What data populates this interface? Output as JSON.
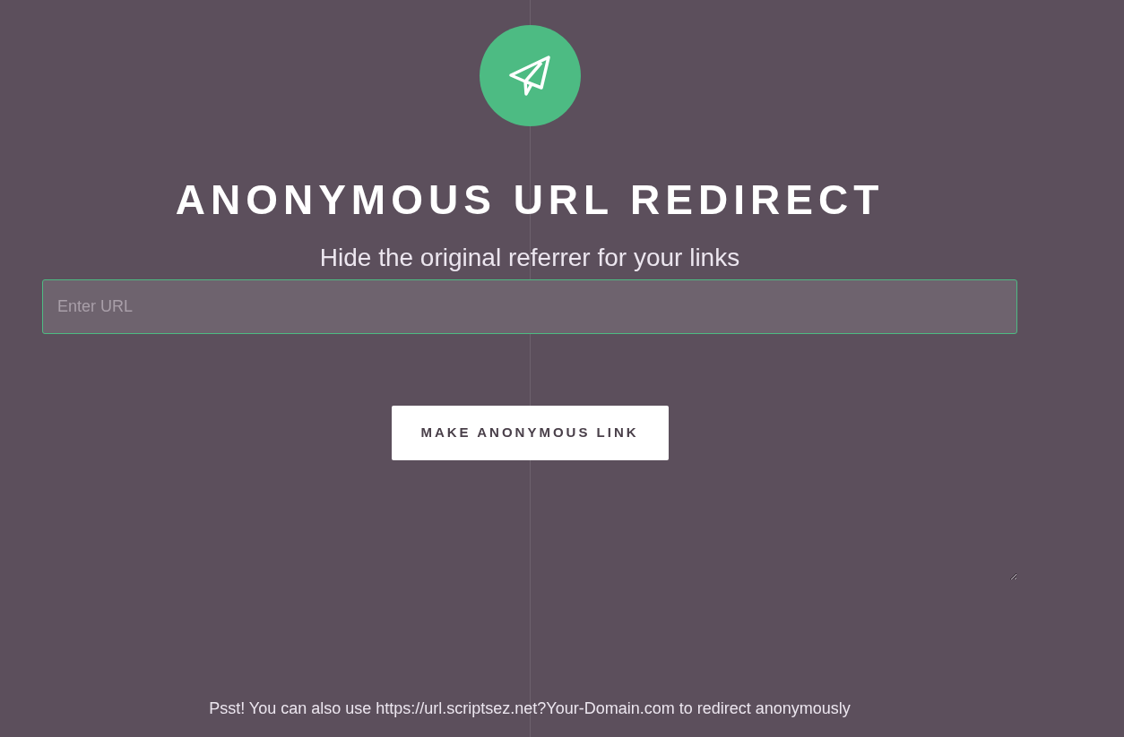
{
  "title": "ANONYMOUS URL REDIRECT",
  "subtitle": "Hide the original referrer for your links",
  "url_field": {
    "placeholder": "Enter URL"
  },
  "button": "MAKE ANONYMOUS LINK",
  "footer": "Psst! You can also use https://url.scriptsez.net?Your-Domain.com to redirect anonymously"
}
